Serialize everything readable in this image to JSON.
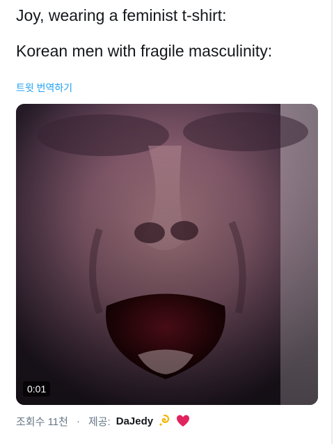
{
  "tweet": {
    "lines": [
      "Joy, wearing a feminist t-shirt:",
      "Korean men with fragile masculinity:"
    ],
    "translate_label": "트윗 번역하기"
  },
  "video": {
    "timestamp": "0:01",
    "thumbnail_icon": "screaming-face-video-frame"
  },
  "meta": {
    "views": "조회수 11천",
    "separator": "·",
    "provider_label": "제공:",
    "provider_name": "DaJedy",
    "emojis": [
      "dizzy-icon",
      "red-heart-icon"
    ]
  },
  "colors": {
    "link": "#1da1f2",
    "secondary_text": "#657786",
    "heart": "#e0245e"
  }
}
